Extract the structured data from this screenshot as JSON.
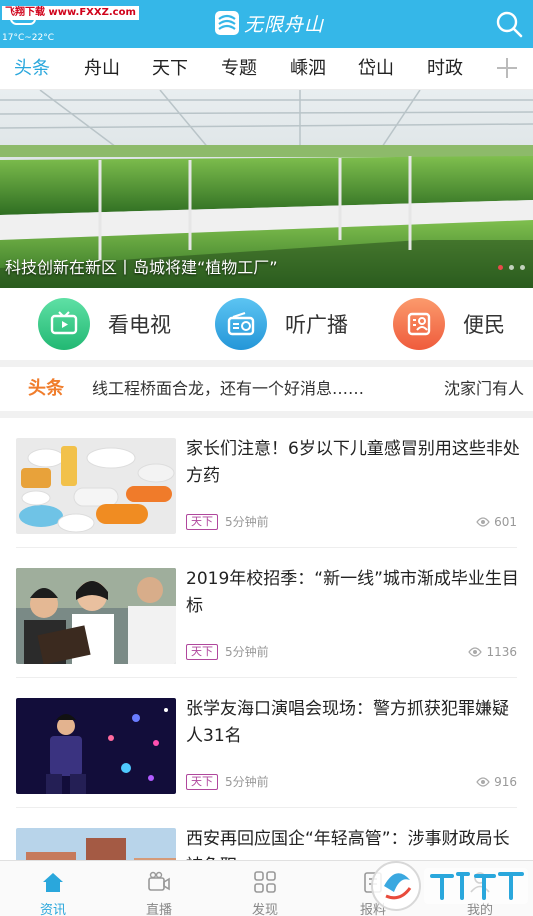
{
  "header": {
    "watermark": "飞翔下载 www.FXXZ.com",
    "temperature": "17°C~22°C",
    "logo_text": "无限舟山"
  },
  "tabs": [
    {
      "label": "头条",
      "active": true
    },
    {
      "label": "舟山",
      "active": false
    },
    {
      "label": "天下",
      "active": false
    },
    {
      "label": "专题",
      "active": false
    },
    {
      "label": "嵊泗",
      "active": false
    },
    {
      "label": "岱山",
      "active": false
    },
    {
      "label": "时政",
      "active": false
    }
  ],
  "banner": {
    "caption": "科技创新在新区丨岛城将建“植物工厂”",
    "slides": 3,
    "active_slide": 1
  },
  "services": [
    {
      "label": "看电视",
      "icon": "tv-icon",
      "color": "#3cc98a"
    },
    {
      "label": "听广播",
      "icon": "radio-icon",
      "color": "#3fa8e0"
    },
    {
      "label": "便民",
      "icon": "service-card-icon",
      "color": "#f36f4c"
    }
  ],
  "ticker": {
    "label": "头条",
    "text": "线工程桥面合龙，还有一个好消息……",
    "text2": "沈家门有人"
  },
  "news": [
    {
      "title": "家长们注意！6岁以下儿童感冒别用这些非处方药",
      "tag": "天下",
      "time": "5分钟前",
      "views": "601"
    },
    {
      "title": "2019年校招季：“新一线”城市渐成毕业生目标",
      "tag": "天下",
      "time": "5分钟前",
      "views": "1136"
    },
    {
      "title": "张学友海口演唱会现场：警方抓获犯罪嫌疑人31名",
      "tag": "天下",
      "time": "5分钟前",
      "views": "916"
    },
    {
      "title": "西安再回应国企“年轻高管”：涉事财政局长被免职",
      "tag": "",
      "time": "",
      "views": ""
    }
  ],
  "bottom_nav": [
    {
      "label": "资讯",
      "icon": "home-icon",
      "active": true
    },
    {
      "label": "直播",
      "icon": "video-camera-icon",
      "active": false
    },
    {
      "label": "发现",
      "icon": "grid-icon",
      "active": false
    },
    {
      "label": "报料",
      "icon": "report-icon",
      "active": false
    },
    {
      "label": "我的",
      "icon": "user-icon",
      "active": false
    }
  ],
  "colors": {
    "header_bg": "#35b7e8",
    "accent": "#2aa7dc",
    "ticker_label": "#f07d2c",
    "tag": "#b0479d"
  }
}
